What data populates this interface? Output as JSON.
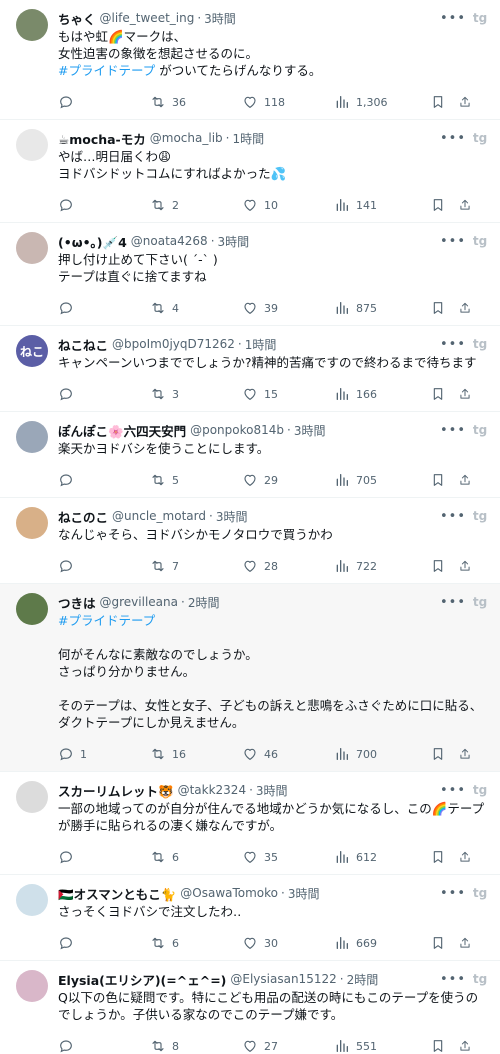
{
  "tweets": [
    {
      "name": "ちゃく",
      "handle": "@life_tweet_ing",
      "time": "3時間",
      "avatar": {
        "initials": "",
        "bg": "#7a8a6a"
      },
      "lines": [
        {
          "text": "もはや虹🌈マークは、"
        },
        {
          "text": "女性迫害の象徴を想起させるのに。"
        },
        {
          "tag": "#プライドテープ",
          "text": " がついてたらげんなりする。"
        }
      ],
      "stats": {
        "replies": "",
        "retweets": "36",
        "likes": "118",
        "views": "1,306"
      }
    },
    {
      "name": "☕mocha-モカ",
      "handle": "@mocha_lib",
      "time": "1時間",
      "avatar": {
        "initials": "",
        "bg": "#e8e8e8"
      },
      "lines": [
        {
          "text": "やば…明日届くわ😩"
        },
        {
          "text": "ヨドバシドットコムにすればよかった💦"
        }
      ],
      "stats": {
        "replies": "",
        "retweets": "2",
        "likes": "10",
        "views": "141"
      }
    },
    {
      "name": "(•ω•｡)💉4",
      "handle": "@noata4268",
      "time": "3時間",
      "avatar": {
        "initials": "",
        "bg": "#c9b7b2"
      },
      "lines": [
        {
          "text": "押し付け止めて下さい( ´-` )"
        },
        {
          "text": "テープは直ぐに捨てますね"
        }
      ],
      "stats": {
        "replies": "",
        "retweets": "4",
        "likes": "39",
        "views": "875"
      }
    },
    {
      "name": "ねこねこ",
      "handle": "@bpoIm0jyqD71262",
      "time": "1時間",
      "avatar": {
        "initials": "ねこ",
        "bg": "#5b5ea6"
      },
      "lines": [
        {
          "text": "キャンペーンいつまででしょうか?精神的苦痛ですので終わるまで待ちます"
        }
      ],
      "stats": {
        "replies": "",
        "retweets": "3",
        "likes": "15",
        "views": "166"
      }
    },
    {
      "name": "ぽんぽこ🌸六四天安門",
      "handle": "@ponpoko814b",
      "time": "3時間",
      "avatar": {
        "initials": "",
        "bg": "#9aa7b8"
      },
      "lines": [
        {
          "text": "楽天かヨドバシを使うことにします。"
        }
      ],
      "stats": {
        "replies": "",
        "retweets": "5",
        "likes": "29",
        "views": "705"
      }
    },
    {
      "name": "ねこのこ",
      "handle": "@uncle_motard",
      "time": "3時間",
      "avatar": {
        "initials": "",
        "bg": "#d8b088"
      },
      "lines": [
        {
          "text": "なんじゃそら、ヨドバシかモノタロウで買うかわ"
        }
      ],
      "stats": {
        "replies": "",
        "retweets": "7",
        "likes": "28",
        "views": "722"
      }
    },
    {
      "name": "つきは",
      "handle": "@grevilleana",
      "time": "2時間",
      "highlight": true,
      "avatar": {
        "initials": "",
        "bg": "#5e7a4a"
      },
      "lines": [
        {
          "tag": "#プライドテープ",
          "text": ""
        },
        {
          "text": ""
        },
        {
          "text": "何がそんなに素敵なのでしょうか。"
        },
        {
          "text": "さっぱり分かりません。"
        },
        {
          "text": ""
        },
        {
          "text": "そのテープは、女性と女子、子どもの訴えと悲鳴をふさぐために口に貼る、"
        },
        {
          "text": "ダクトテープにしか見えません。"
        }
      ],
      "stats": {
        "replies": "1",
        "retweets": "16",
        "likes": "46",
        "views": "700"
      }
    },
    {
      "name": "スカーリムレット🐯",
      "handle": "@takk2324",
      "time": "3時間",
      "avatar": {
        "initials": "",
        "bg": "#dcdcdc"
      },
      "lines": [
        {
          "text": "一部の地域ってのが自分が住んでる地域かどうか気になるし、この🌈テープ"
        },
        {
          "text": "が勝手に貼られるの凄く嫌なんですが。"
        }
      ],
      "stats": {
        "replies": "",
        "retweets": "6",
        "likes": "35",
        "views": "612"
      }
    },
    {
      "name": "🇵🇸オスマンともこ🐈",
      "handle": "@OsawaTomoko",
      "time": "3時間",
      "avatar": {
        "initials": "",
        "bg": "#cfe0ea"
      },
      "lines": [
        {
          "text": "さっそくヨドバシで注文したわ‥"
        }
      ],
      "stats": {
        "replies": "",
        "retweets": "6",
        "likes": "30",
        "views": "669"
      }
    },
    {
      "name": "Elysia(エリシア)(=^ェ^=)",
      "handle": "@Elysiasan15122",
      "time": "2時間",
      "avatar": {
        "initials": "",
        "bg": "#d9b7c9"
      },
      "lines": [
        {
          "text": "Q以下の色に疑問です。特にこども用品の配送の時にもこのテープを使うの"
        },
        {
          "text": "でしょうか。子供いる家なのでこのテープ嫌です。"
        }
      ],
      "stats": {
        "replies": "",
        "retweets": "8",
        "likes": "27",
        "views": "551"
      }
    }
  ],
  "icons": {
    "more": "more-icon",
    "x_logo": "x-logo-icon",
    "reply": "reply-icon",
    "retweet": "retweet-icon",
    "like": "heart-icon",
    "views": "views-icon",
    "bookmark": "bookmark-icon",
    "share": "share-icon"
  },
  "colors": {
    "accent": "#1d9bf0",
    "muted": "#536471",
    "highlight_bg": "#f7f7f7"
  }
}
